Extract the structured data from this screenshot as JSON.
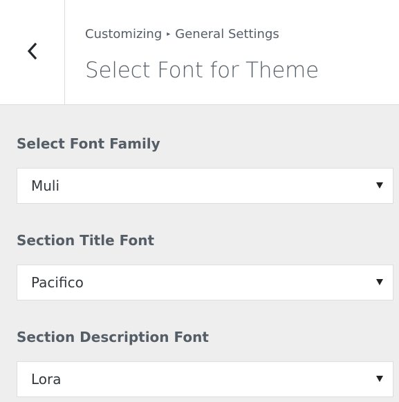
{
  "header": {
    "back_icon": "chevron-left-icon",
    "breadcrumb": {
      "root": "Customizing",
      "separator": "▸",
      "section": "General Settings"
    },
    "title": "Select Font for Theme"
  },
  "controls": [
    {
      "label": "Select Font Family",
      "value": "Muli"
    },
    {
      "label": "Section Title Font",
      "value": "Pacifico"
    },
    {
      "label": "Section Description Font",
      "value": "Lora"
    }
  ],
  "colors": {
    "header_bg": "#ffffff",
    "panel_bg": "#eeeeee",
    "border": "#dddddd",
    "text": "#555d66"
  }
}
